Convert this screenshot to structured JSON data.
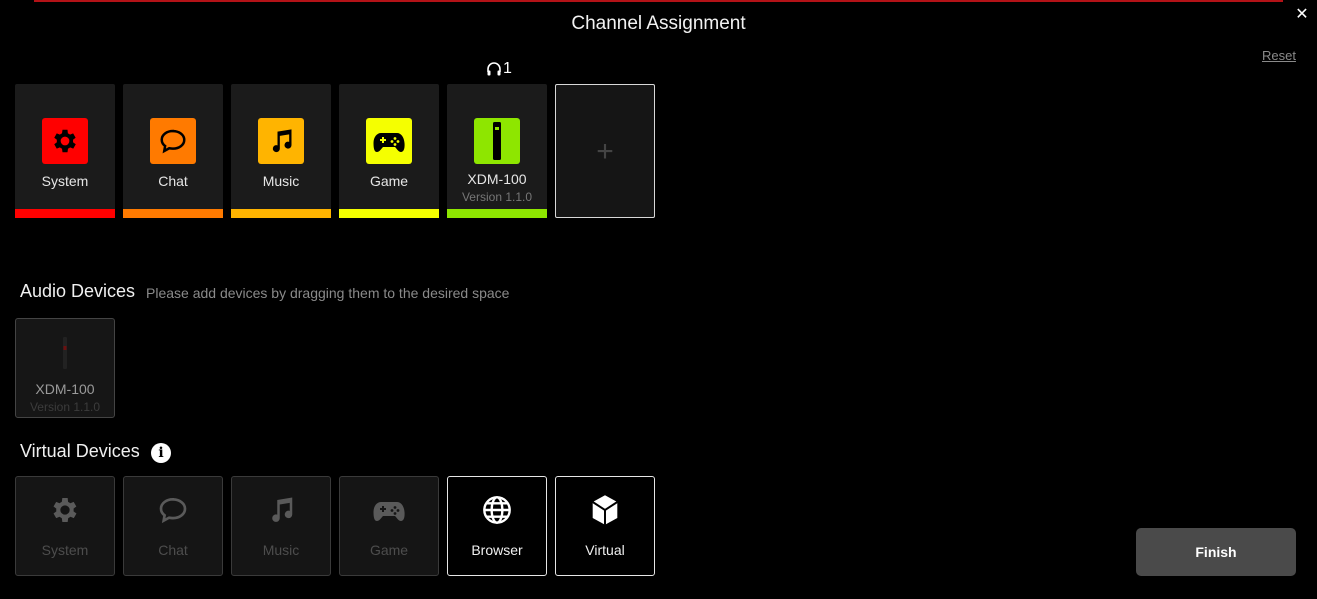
{
  "header": {
    "title": "Channel Assignment",
    "close_glyph": "✕",
    "reset_label": "Reset"
  },
  "channel_count": "1",
  "channels": [
    {
      "label": "System",
      "icon": "gear-icon",
      "color": "#ff0000"
    },
    {
      "label": "Chat",
      "icon": "chat-bubble-icon",
      "color": "#ff7a00"
    },
    {
      "label": "Music",
      "icon": "music-note-icon",
      "color": "#ffb400"
    },
    {
      "label": "Game",
      "icon": "gamepad-icon",
      "color": "#f5ff00"
    },
    {
      "label": "XDM-100",
      "sub": "Version 1.1.0",
      "icon": "microphone-icon",
      "color": "#8ee600"
    }
  ],
  "add_glyph": "+",
  "audio_devices": {
    "title": "Audio Devices",
    "hint": "Please add devices by dragging them to the desired space",
    "items": [
      {
        "label": "XDM-100",
        "sub": "Version 1.1.0",
        "icon": "microphone-icon"
      }
    ]
  },
  "virtual_devices": {
    "title": "Virtual Devices",
    "info_glyph": "i",
    "items": [
      {
        "label": "System",
        "icon": "gear-icon",
        "enabled": false
      },
      {
        "label": "Chat",
        "icon": "chat-bubble-icon",
        "enabled": false
      },
      {
        "label": "Music",
        "icon": "music-note-icon",
        "enabled": false
      },
      {
        "label": "Game",
        "icon": "gamepad-icon",
        "enabled": false
      },
      {
        "label": "Browser",
        "icon": "globe-icon",
        "enabled": true
      },
      {
        "label": "Virtual",
        "icon": "cube-icon",
        "enabled": true
      }
    ]
  },
  "finish_label": "Finish"
}
